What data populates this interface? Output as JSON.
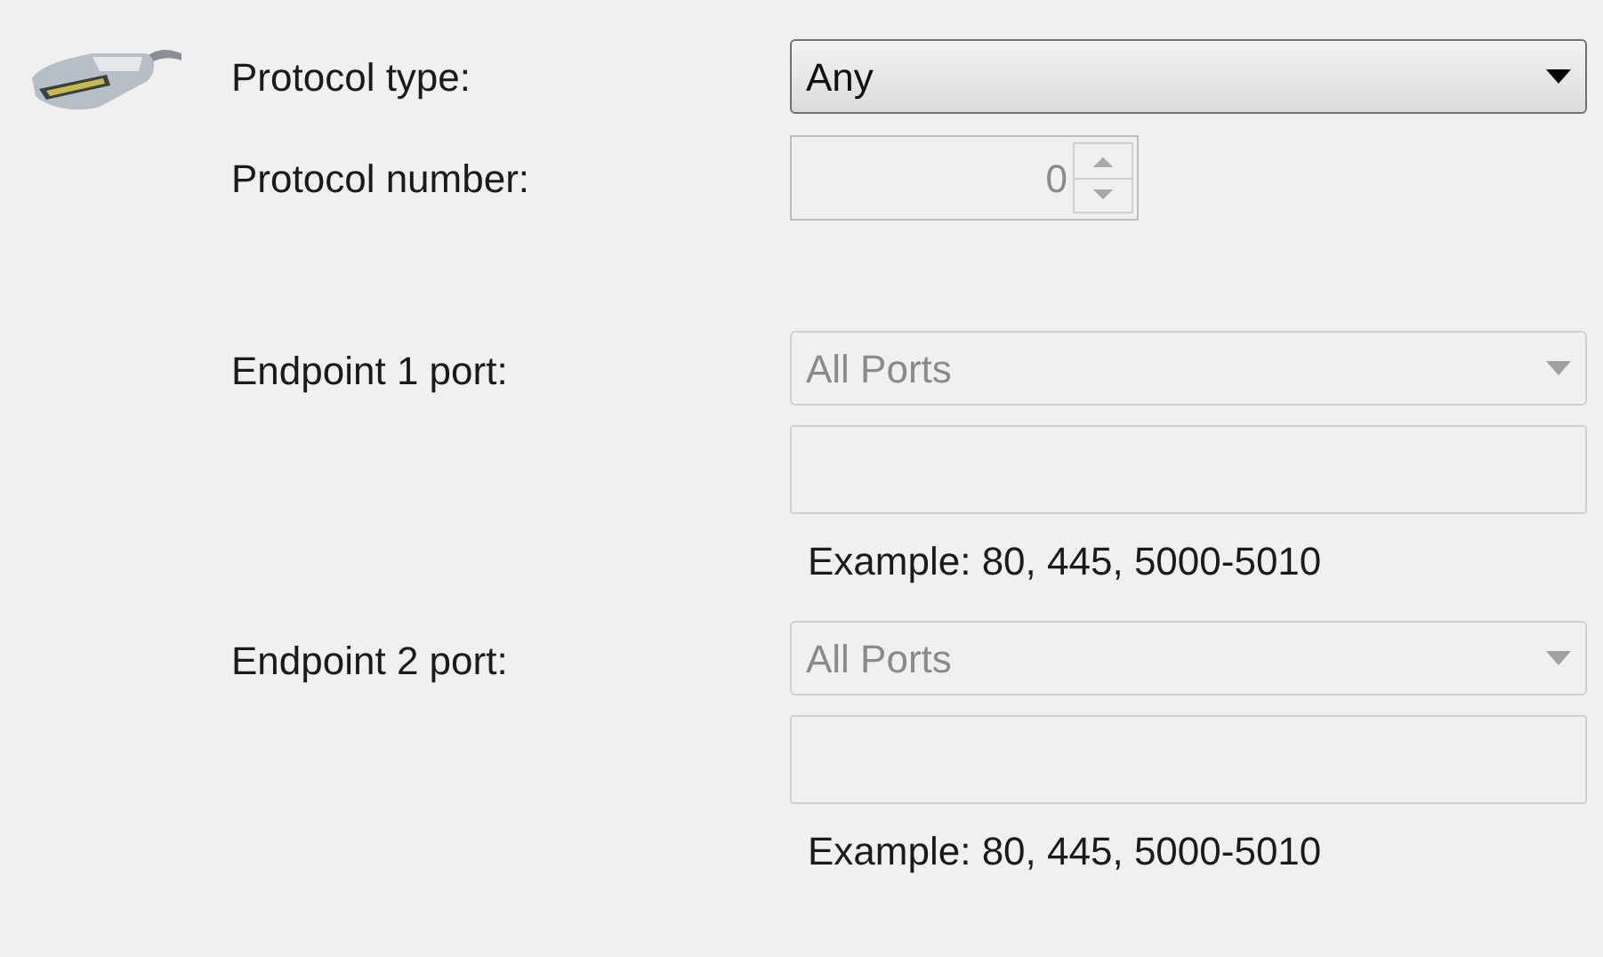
{
  "protocol_type": {
    "label": "Protocol type:",
    "value": "Any",
    "disabled": false
  },
  "protocol_number": {
    "label": "Protocol number:",
    "value": "0",
    "disabled": true
  },
  "endpoints": [
    {
      "label": "Endpoint 1 port:",
      "port_select": {
        "value": "All Ports",
        "disabled": true
      },
      "port_field": {
        "disabled": true
      },
      "example": "Example: 80, 445, 5000-5010"
    },
    {
      "label": "Endpoint 2 port:",
      "port_select": {
        "value": "All Ports",
        "disabled": true
      },
      "port_field": {
        "disabled": true
      },
      "example": "Example: 80, 445, 5000-5010"
    }
  ]
}
